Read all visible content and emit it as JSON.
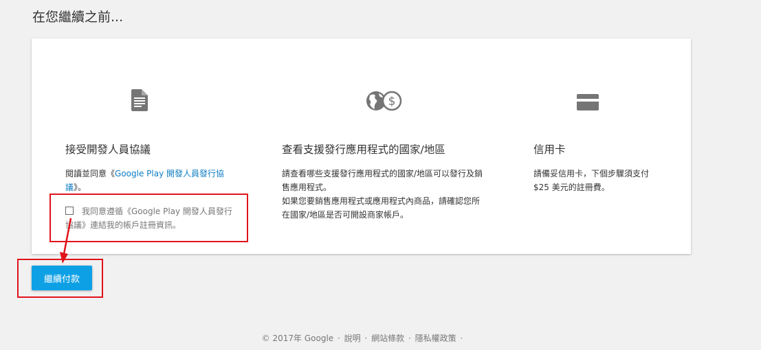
{
  "page_title": "在您繼續之前...",
  "columns": [
    {
      "icon": "document-icon",
      "heading": "接受開發人員協議",
      "body_prefix": "閱讀並同意《",
      "body_link": "Google Play 開發人員發行協議",
      "body_suffix": "》。",
      "checkbox_label": "我同意遵循《Google Play 開發人員發行協議》連結我的帳戶註冊資訊。"
    },
    {
      "icon": "globe-dollar-icon",
      "heading": "查看支援發行應用程式的國家/地區",
      "body_line1": "請查看哪些支援發行應用程式的國家/地區可以發行及銷售應用程式。",
      "body_line2": "如果您要銷售應用程式或應用程式內商品，請確認您所在國家/地區是否可開設商家帳戶。"
    },
    {
      "icon": "credit-card-icon",
      "heading": "信用卡",
      "body": "請備妥信用卡，下個步驟須支付 $25 美元的註冊費。"
    }
  ],
  "continue_button": "繼續付款",
  "footer": {
    "copyright": "© 2017年 Google",
    "sep": "·",
    "links": [
      "說明",
      "網站條款",
      "隱私權政策"
    ]
  },
  "colors": {
    "accent": "#0ea0e5",
    "link": "#0e7dc2",
    "annotation": "#e0121b"
  }
}
